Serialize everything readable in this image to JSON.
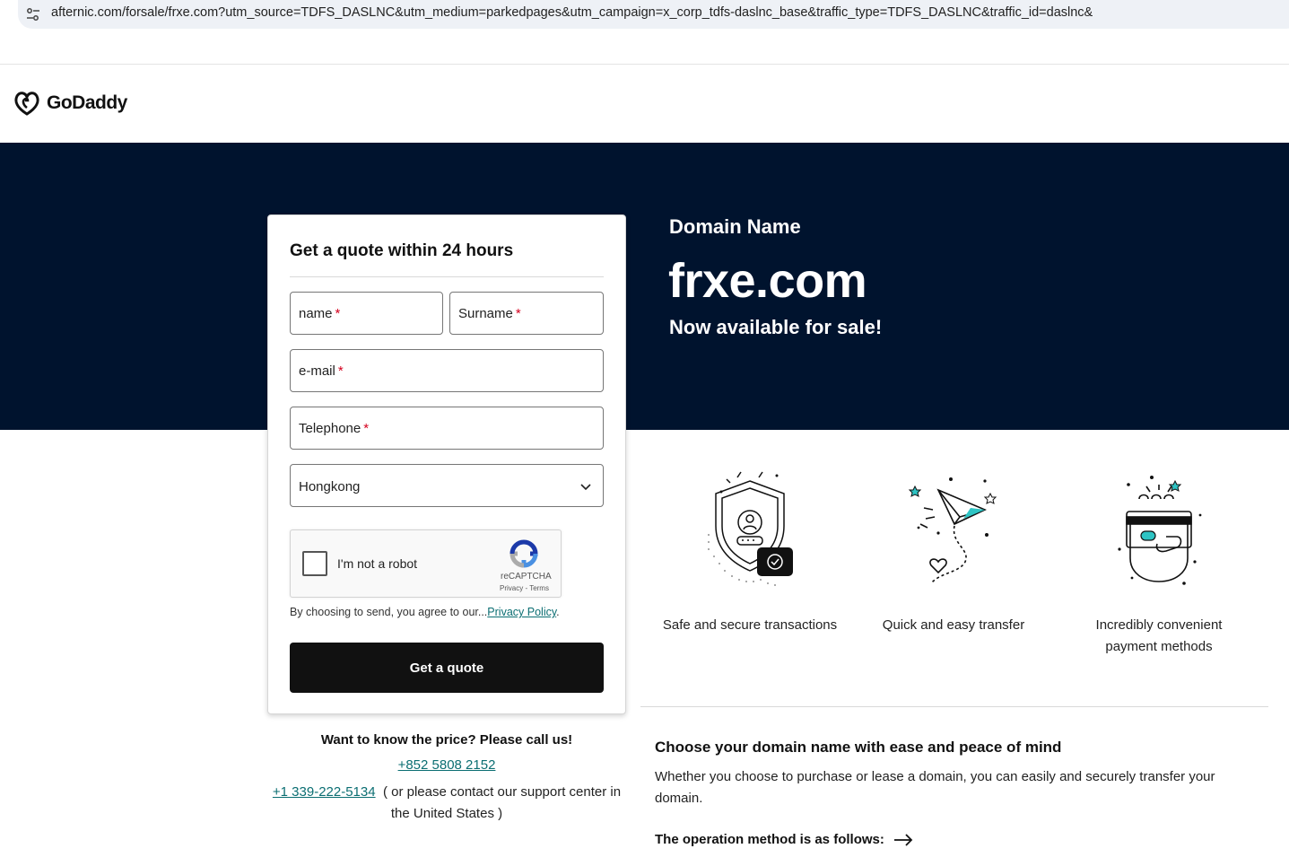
{
  "browser": {
    "url": "afternic.com/forsale/frxe.com?utm_source=TDFS_DASLNC&utm_medium=parkedpages&utm_campaign=x_corp_tdfs-daslnc_base&traffic_type=TDFS_DASLNC&traffic_id=daslnc&",
    "site_info_icon": "tune-icon"
  },
  "header": {
    "logo_text": "GoDaddy",
    "logo_icon": "godaddy-logo-icon"
  },
  "hero": {
    "label": "Domain Name",
    "domain": "frxe.com",
    "availability": "Now available for sale!",
    "background": "#00132e"
  },
  "form": {
    "title": "Get a quote within 24 hours",
    "fields": {
      "name": "name",
      "surname": "Surname",
      "email": "e-mail",
      "telephone": "Telephone",
      "required_mark": "*"
    },
    "country_select": {
      "value": "Hongkong"
    },
    "captcha": {
      "label": "I'm not a robot",
      "brand": "reCAPTCHA",
      "links": "Privacy - Terms"
    },
    "consent_text": "By choosing to send, you agree to our...",
    "consent_link": "Privacy Policy",
    "consent_end": ".",
    "submit_label": "Get a quote"
  },
  "contact": {
    "question": "Want to know the price? Please call us!",
    "phone_hk": "+852 5808 2152",
    "phone_us": "+1 339-222-5134",
    "phone_us_note": "( or please contact our support center in the United States )"
  },
  "features": [
    {
      "label": "Safe and secure transactions",
      "icon": "secure-shield-icon"
    },
    {
      "label": "Quick and easy transfer",
      "icon": "paper-plane-icon"
    },
    {
      "label": "Incredibly convenient payment methods",
      "icon": "payment-card-icon"
    }
  ],
  "ease": {
    "title": "Choose your domain name with ease and peace of mind",
    "body": "Whether you choose to purchase or lease a domain, you can easily and securely transfer your domain.",
    "link_label": "The operation method is as follows:"
  },
  "colors": {
    "accent_link": "#0b6e72",
    "cta": "#111111",
    "required": "#d4001e"
  }
}
